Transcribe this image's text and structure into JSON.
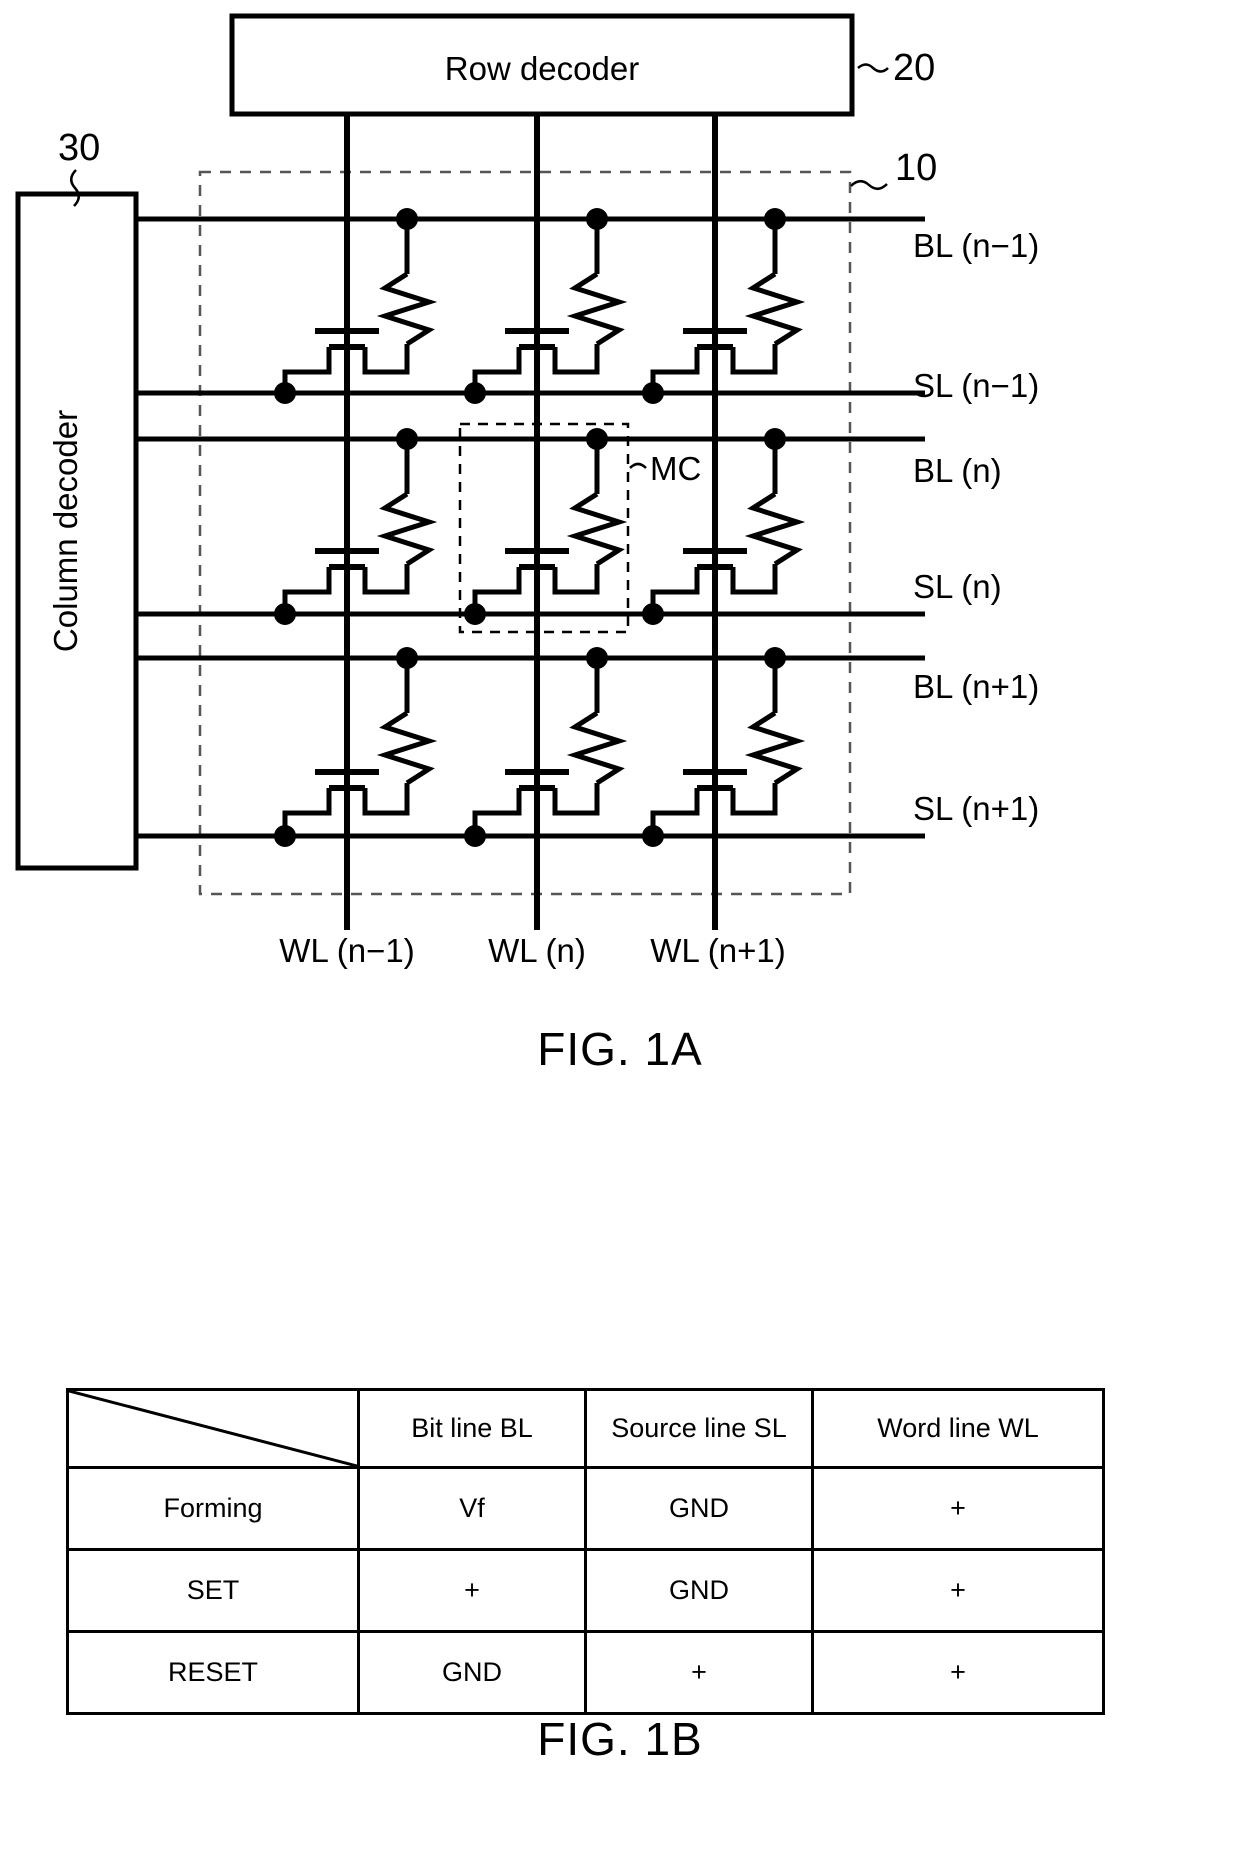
{
  "figure_1a": {
    "caption": "FIG. 1A",
    "blocks": {
      "row_decoder": {
        "label": "Row decoder",
        "ref": "20"
      },
      "column_decoder": {
        "label": "Column decoder",
        "ref": "30"
      },
      "memory_array": {
        "ref": "10"
      },
      "memory_cell": {
        "label": "MC"
      }
    },
    "bit_lines": [
      "BL (n−1)",
      "BL (n)",
      "BL (n+1)"
    ],
    "source_lines": [
      "SL (n−1)",
      "SL (n)",
      "SL (n+1)"
    ],
    "word_lines": [
      "WL (n−1)",
      "WL (n)",
      "WL (n+1)"
    ]
  },
  "figure_1b": {
    "caption": "FIG. 1B",
    "table": {
      "corner_header": "",
      "columns": [
        "Bit line BL",
        "Source line SL",
        "Word line WL"
      ],
      "rows": [
        {
          "operation": "Forming",
          "values": [
            "Vf",
            "GND",
            "+"
          ]
        },
        {
          "operation": "SET",
          "values": [
            "+",
            "GND",
            "+"
          ]
        },
        {
          "operation": "RESET",
          "values": [
            "GND",
            "+",
            "+"
          ]
        }
      ]
    }
  },
  "colors": {
    "ink": "#000000",
    "paper": "#ffffff",
    "dashed": "#555555"
  }
}
